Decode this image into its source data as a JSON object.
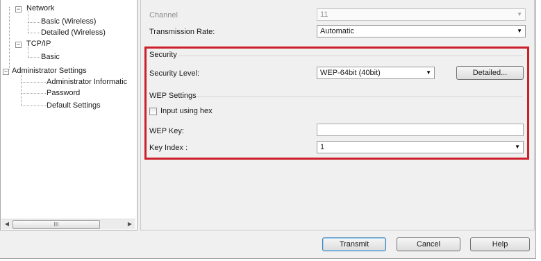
{
  "tree": {
    "items": [
      {
        "label": "Network",
        "expander": "−"
      },
      {
        "label": "Basic (Wireless)"
      },
      {
        "label": "Detailed (Wireless)"
      },
      {
        "label": "TCP/IP",
        "expander": "−"
      },
      {
        "label": "Basic"
      },
      {
        "label": "Administrator Settings",
        "expander": "−"
      },
      {
        "label": "Administrator Informatic"
      },
      {
        "label": "Password"
      },
      {
        "label": "Default Settings"
      }
    ],
    "scroll_left": "◀",
    "scroll_right": "▶",
    "scroll_thumb_grip": "III"
  },
  "panel": {
    "channel_label": "Channel",
    "channel_value": "11",
    "transmission_rate_label": "Transmission Rate:",
    "transmission_rate_value": "Automatic",
    "security": {
      "section_label": "Security",
      "level_label": "Security Level:",
      "level_value": "WEP-64bit (40bit)",
      "detailed_button": "Detailed..."
    },
    "wep": {
      "section_label": "WEP Settings",
      "hex_checkbox_label": "Input using hex",
      "hex_checked": false,
      "key_label": "WEP Key:",
      "key_value": "",
      "index_label": "Key Index :",
      "index_value": "1"
    },
    "caret": "▼"
  },
  "footer": {
    "transmit": "Transmit",
    "cancel": "Cancel",
    "help": "Help"
  },
  "colors": {
    "highlight_border": "#cc1f2a",
    "window_bg": "#f0f0f0"
  }
}
